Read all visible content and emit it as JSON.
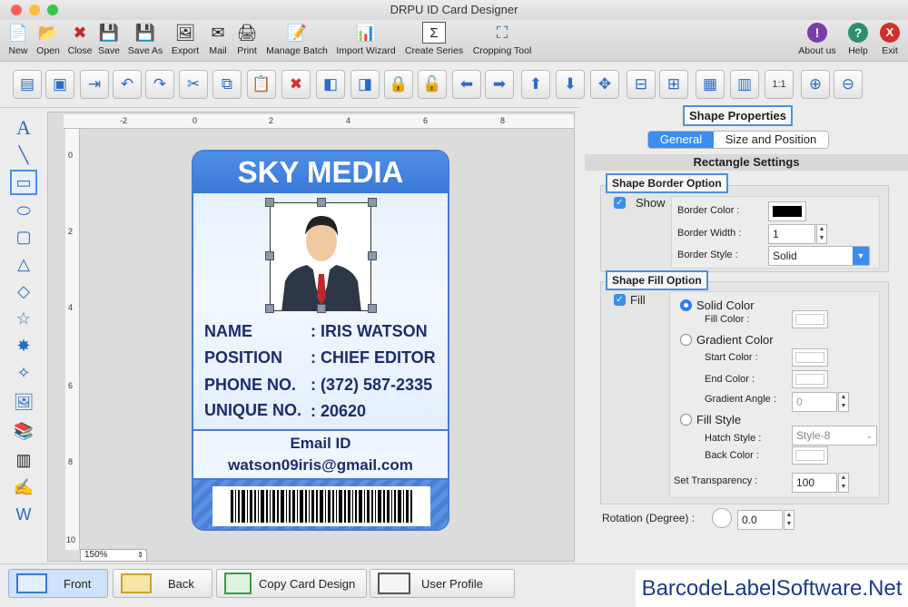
{
  "window": {
    "title": "DRPU ID Card Designer"
  },
  "toolbar": {
    "items": [
      "New",
      "Open",
      "Close",
      "Save",
      "Save As",
      "Export",
      "Mail",
      "Print",
      "Manage Batch",
      "Import Wizard",
      "Create Series",
      "Cropping Tool"
    ],
    "right": [
      "About us",
      "Help",
      "Exit"
    ]
  },
  "card": {
    "company": "SKY MEDIA",
    "rows": [
      {
        "label": "NAME",
        "value": ": IRIS WATSON"
      },
      {
        "label": "POSITION",
        "value": ": CHIEF EDITOR"
      },
      {
        "label": "PHONE NO.",
        "value": ": (372) 587-2335"
      },
      {
        "label": "UNIQUE NO.",
        "value": ": 20620"
      }
    ],
    "email_label": "Email ID",
    "email": "watson09iris@gmail.com"
  },
  "canvas": {
    "zoom": "150%",
    "ruler_h": [
      "-2",
      "0",
      "2",
      "4",
      "6",
      "8"
    ],
    "ruler_v": [
      "0",
      "2",
      "4",
      "6",
      "8",
      "10"
    ]
  },
  "panel": {
    "title": "Shape Properties",
    "tabs": [
      "General",
      "Size and Position"
    ],
    "section": "Rectangle Settings",
    "border": {
      "title": "Shape Border Option",
      "show_label": "Show",
      "color_label": "Border Color :",
      "width_label": "Border Width :",
      "width_value": "1",
      "style_label": "Border Style :",
      "style_value": "Solid",
      "color": "#000000"
    },
    "fill": {
      "title": "Shape Fill Option",
      "fill_label": "Fill",
      "solid_label": "Solid Color",
      "fill_color_label": "Fill Color :",
      "gradient_label": "Gradient Color",
      "start_label": "Start Color :",
      "end_label": "End Color :",
      "angle_label": "Gradient Angle :",
      "angle_value": "0",
      "fillstyle_label": "Fill Style",
      "hatch_label": "Hatch Style :",
      "hatch_value": "Style-8",
      "back_label": "Back Color :",
      "transparency_label": "Set Transparency :",
      "transparency_value": "100"
    },
    "rotation_label": "Rotation (Degree) :",
    "rotation_value": "0.0"
  },
  "bottom": {
    "buttons": [
      "Front",
      "Back",
      "Copy Card Design",
      "User Profile"
    ]
  },
  "brand": "BarcodeLabelSoftware.Net"
}
